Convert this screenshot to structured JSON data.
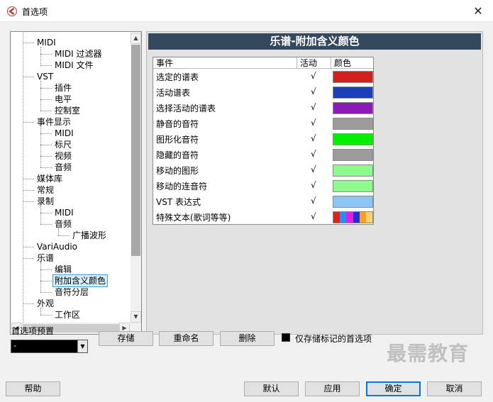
{
  "window": {
    "title": "首选项",
    "close_glyph": "✕"
  },
  "colors": {
    "header_bg": "#34495e",
    "selection_bg": "#d7ecf8",
    "selection_border": "#3aa0d8"
  },
  "icons": {
    "app": "cubase-logo-icon",
    "close": "close-icon",
    "scroll_up": "▲",
    "scroll_down": "▼",
    "scroll_left": "◀",
    "scroll_right": "▶",
    "combo_drop": "▼"
  },
  "tree": [
    {
      "label": "MIDI",
      "level": 1
    },
    {
      "label": "MIDI 过滤器",
      "level": 2
    },
    {
      "label": "MIDI 文件",
      "level": 2
    },
    {
      "label": "VST",
      "level": 1
    },
    {
      "label": "插件",
      "level": 2
    },
    {
      "label": "电平",
      "level": 2
    },
    {
      "label": "控制室",
      "level": 2
    },
    {
      "label": "事件显示",
      "level": 1
    },
    {
      "label": "MIDI",
      "level": 2
    },
    {
      "label": "标尺",
      "level": 2
    },
    {
      "label": "视频",
      "level": 2
    },
    {
      "label": "音频",
      "level": 2
    },
    {
      "label": "媒体库",
      "level": 1
    },
    {
      "label": "常规",
      "level": 1
    },
    {
      "label": "录制",
      "level": 1
    },
    {
      "label": "MIDI",
      "level": 2
    },
    {
      "label": "音频",
      "level": 2
    },
    {
      "label": "广播波形",
      "level": 3
    },
    {
      "label": "VariAudio",
      "level": 1
    },
    {
      "label": "乐谱",
      "level": 1
    },
    {
      "label": "编辑",
      "level": 2
    },
    {
      "label": "附加含义颜色",
      "level": 2,
      "selected": true
    },
    {
      "label": "音符分层",
      "level": 2
    },
    {
      "label": "外观",
      "level": 1
    },
    {
      "label": "工作区",
      "level": 2
    }
  ],
  "section": {
    "title": "乐谱-附加含义颜色"
  },
  "table": {
    "headers": {
      "event": "事件",
      "active": "活动",
      "color": "颜色"
    },
    "rows": [
      {
        "name": "选定的谱表",
        "active": "√",
        "color": "#d21f1f"
      },
      {
        "name": "活动谱表",
        "active": "√",
        "color": "#1c3db8"
      },
      {
        "name": "选择活动的谱表",
        "active": "√",
        "color": "#8c1ab8"
      },
      {
        "name": "静音的音符",
        "active": "√",
        "color": "#9c9c9c"
      },
      {
        "name": "图形化音符",
        "active": "√",
        "color": "#00f000"
      },
      {
        "name": "隐藏的音符",
        "active": "√",
        "color": "#9c9c9c"
      },
      {
        "name": "移动的图形",
        "active": "√",
        "color": "#8cfa8c"
      },
      {
        "name": "移动的连音符",
        "active": "√",
        "color": "#8cfa8c"
      },
      {
        "name": "VST 表达式",
        "active": "√",
        "color": "#8cc4f5"
      },
      {
        "name": "特殊文本(歌词等等)",
        "active": "√",
        "color": "rainbow"
      }
    ],
    "rainbow": [
      "#e0201a",
      "#1e90ff",
      "#e01fe0",
      "#2030d8",
      "#ff9f1a",
      "#ffd070"
    ]
  },
  "preset": {
    "label": "首选项预置",
    "value": "-"
  },
  "buttons": {
    "store": "存储",
    "rename": "重命名",
    "delete": "删除",
    "help": "帮助",
    "default": "默认",
    "apply": "应用",
    "ok": "确定",
    "cancel": "取消"
  },
  "checkbox": {
    "label": "仅存储标记的首选项"
  },
  "watermark": "最需教育"
}
